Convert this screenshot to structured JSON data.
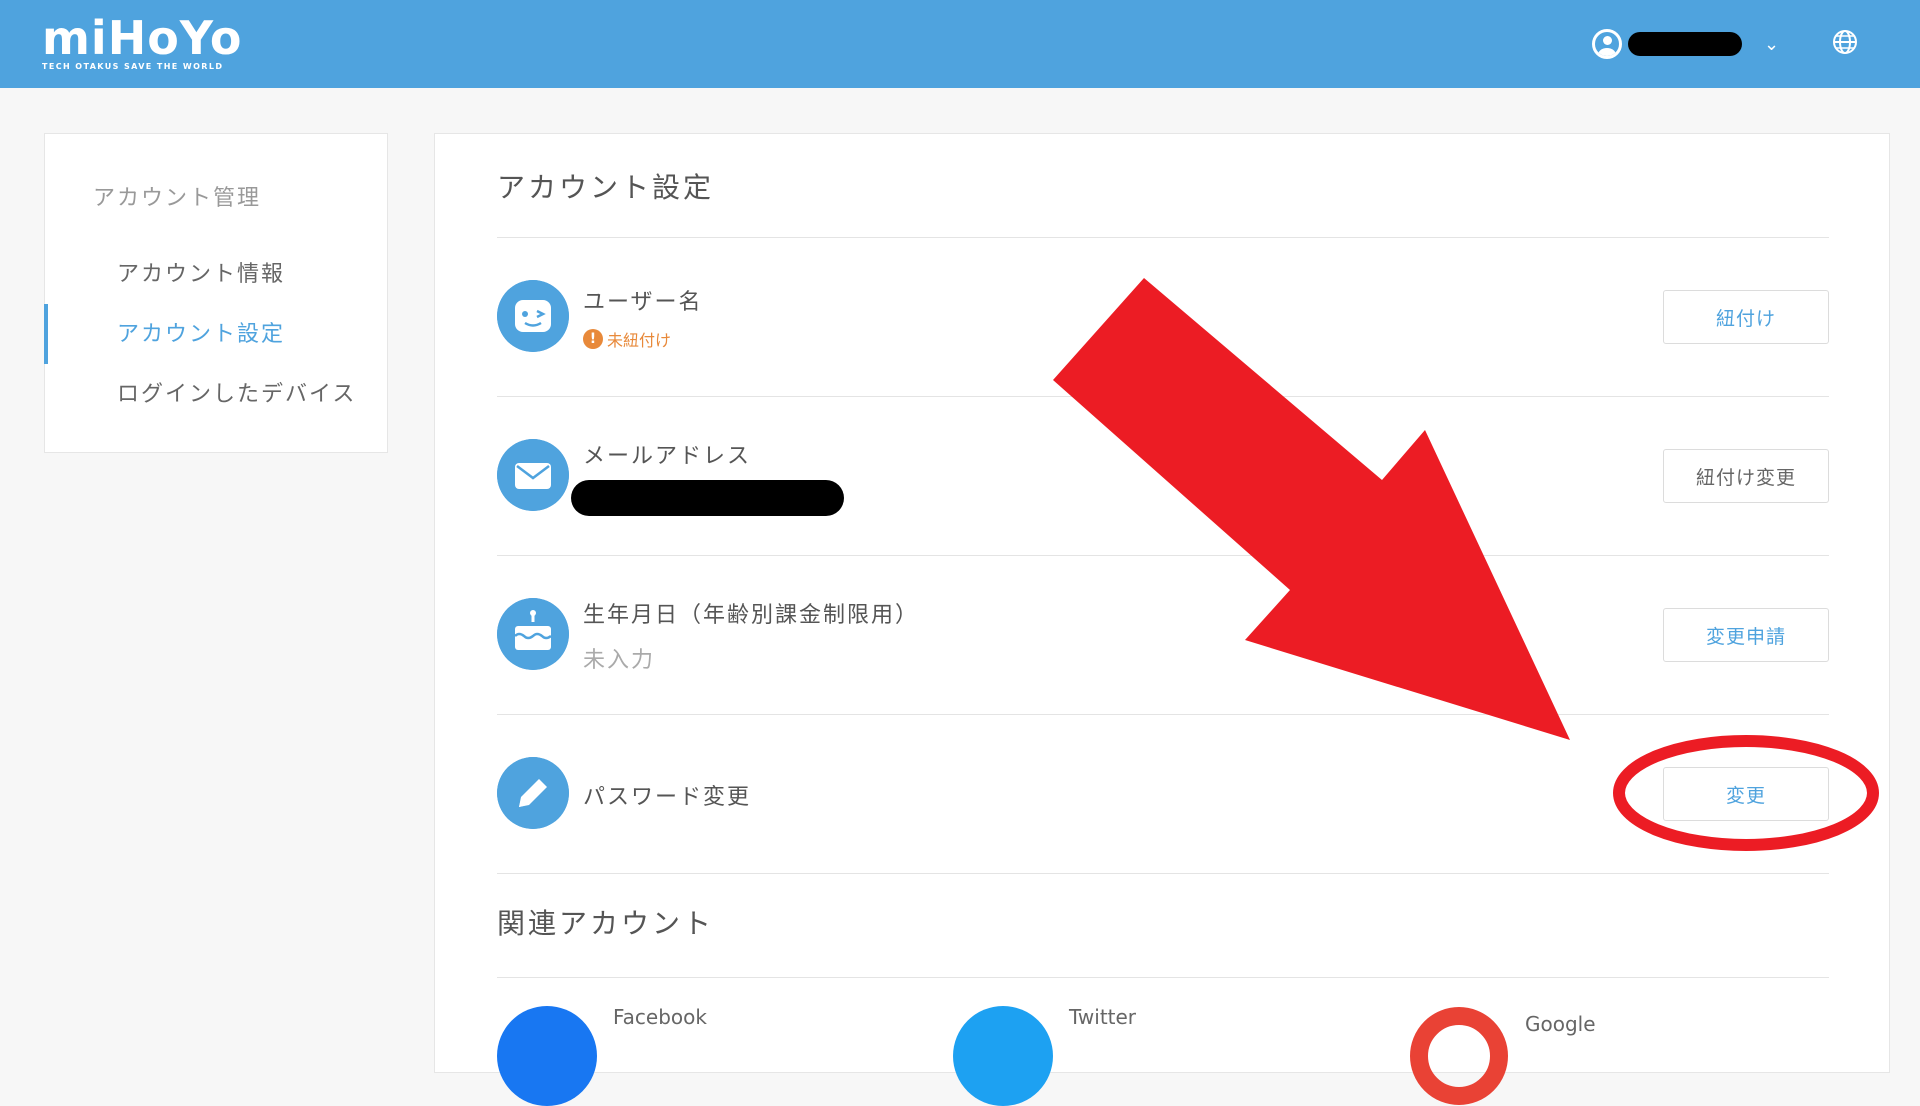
{
  "header": {
    "logo_text": "miHoYo",
    "logo_tagline": "TECH OTAKUS SAVE THE WORLD",
    "chevron": "⌄",
    "colors": {
      "bar": "#4fa3de"
    }
  },
  "sidebar": {
    "title": "アカウント管理",
    "items": [
      {
        "label": "アカウント情報"
      },
      {
        "label": "アカウント設定"
      },
      {
        "label": "ログインしたデバイス"
      }
    ]
  },
  "main": {
    "title": "アカウント設定",
    "rows": [
      {
        "icon": "face-icon",
        "label": "ユーザー名",
        "status": "未紐付け",
        "button": "紐付け"
      },
      {
        "icon": "mail-icon",
        "label": "メールアドレス",
        "button": "紐付け変更"
      },
      {
        "icon": "cake-icon",
        "label": "生年月日（年齢別課金制限用）",
        "value": "未入力",
        "button": "変更申請"
      },
      {
        "icon": "pencil-icon",
        "label": "パスワード変更",
        "button": "変更"
      }
    ],
    "linked_title": "関連アカウント",
    "linked": [
      {
        "icon": "facebook-icon",
        "label": "Facebook"
      },
      {
        "icon": "twitter-icon",
        "label": "Twitter"
      },
      {
        "icon": "google-icon",
        "label": "Google"
      }
    ]
  },
  "colors": {
    "accent": "#4fa3de",
    "warning": "#e8893a",
    "annotation": "#ec1c24"
  }
}
